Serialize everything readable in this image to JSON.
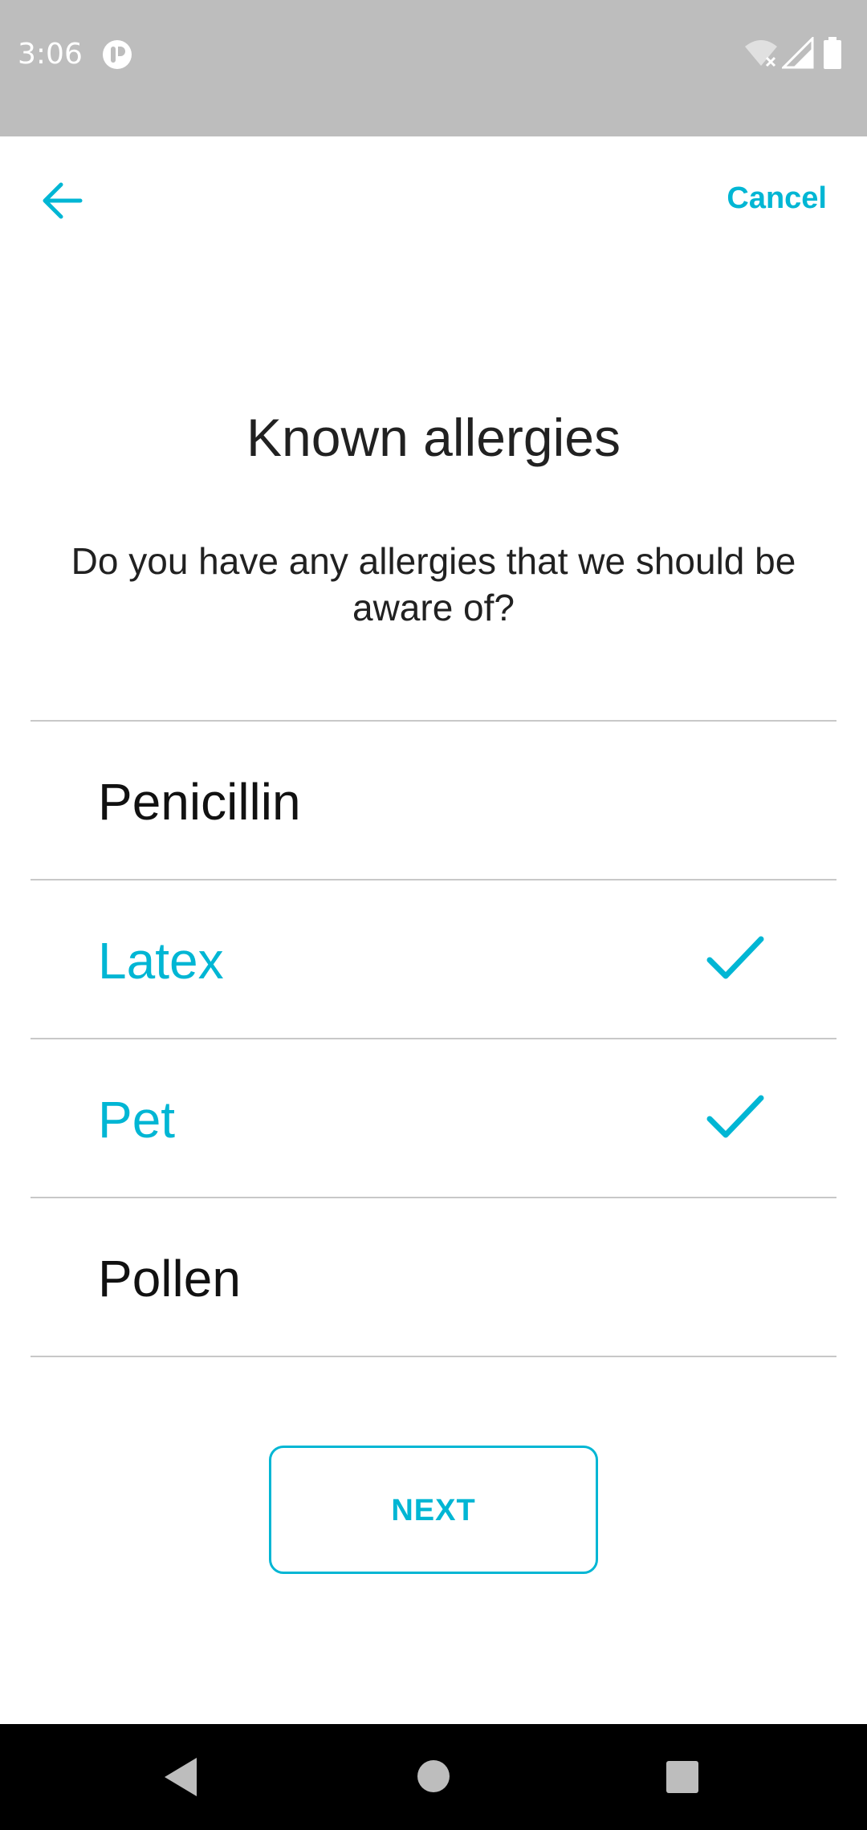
{
  "status_bar": {
    "time": "3:06",
    "icons": [
      "app-notification-icon",
      "wifi-off-icon",
      "signal-icon",
      "battery-icon"
    ]
  },
  "header": {
    "back_icon": "arrow-left-icon",
    "cancel_label": "Cancel"
  },
  "page": {
    "title": "Known allergies",
    "subtitle": "Do you have any allergies that we should be aware of?"
  },
  "allergies": {
    "items": [
      {
        "label": "Penicillin",
        "selected": false
      },
      {
        "label": "Latex",
        "selected": true
      },
      {
        "label": "Pet",
        "selected": true
      },
      {
        "label": "Pollen",
        "selected": false
      }
    ]
  },
  "actions": {
    "next_label": "NEXT"
  },
  "nav_bar": {
    "icons": [
      "back-triangle-icon",
      "home-circle-icon",
      "recents-square-icon"
    ]
  },
  "colors": {
    "accent": "#00b6d4",
    "status_bar": "#bdbdbd",
    "text_dark": "#212121",
    "divider": "#c8c8c8",
    "nav_bar": "#000000"
  }
}
